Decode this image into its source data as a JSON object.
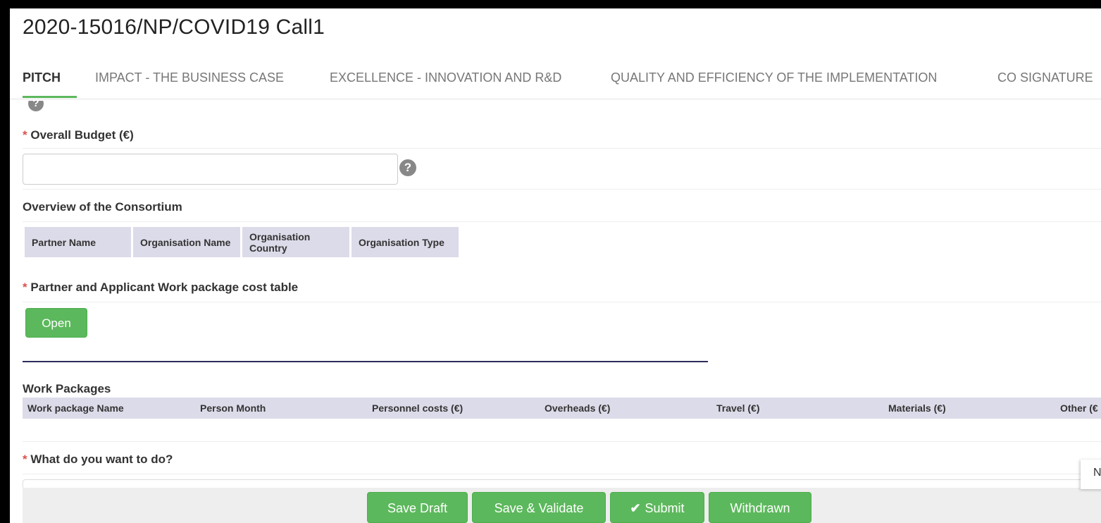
{
  "page": {
    "title": "2020-15016/NP/COVID19 Call1"
  },
  "tabs": [
    {
      "label": "PITCH",
      "active": true
    },
    {
      "label": "IMPACT - THE BUSINESS CASE",
      "active": false
    },
    {
      "label": "EXCELLENCE - INNOVATION AND R&D",
      "active": false
    },
    {
      "label": "QUALITY AND EFFICIENCY OF THE IMPLEMENTATION",
      "active": false
    },
    {
      "label": "CO SIGNATURE",
      "active": false
    }
  ],
  "icons": {
    "help": "?",
    "help_icon_name": "question-circle-icon",
    "check_icon_name": "checkmark-icon",
    "check": "✔"
  },
  "budget": {
    "required_marker": "*",
    "label": "Overall Budget (€)",
    "value": ""
  },
  "consortium": {
    "title": "Overview of the Consortium",
    "columns": [
      "Partner Name",
      "Organisation Name",
      "Organisation Country",
      "Organisation Type"
    ]
  },
  "cost_table": {
    "required_marker": "*",
    "label": "Partner and Applicant Work package cost table",
    "open_label": "Open"
  },
  "work_packages": {
    "title": "Work Packages",
    "columns": [
      "Work package Name",
      "Person Month",
      "Personnel costs (€)",
      "Overheads (€)",
      "Travel (€)",
      "Materials (€)",
      "Other (€"
    ]
  },
  "question": {
    "required_marker": "*",
    "label": "What do you want to do?"
  },
  "side_popup": {
    "text": "N"
  },
  "footer": {
    "save_draft": "Save Draft",
    "save_validate": "Save & Validate",
    "submit": "Submit",
    "withdrawn": "Withdrawn"
  },
  "colors": {
    "accent_green": "#5cb85c",
    "required_red": "#d9534f",
    "table_header": "#dcdbe9",
    "navy_rule": "#2c2c5a"
  }
}
